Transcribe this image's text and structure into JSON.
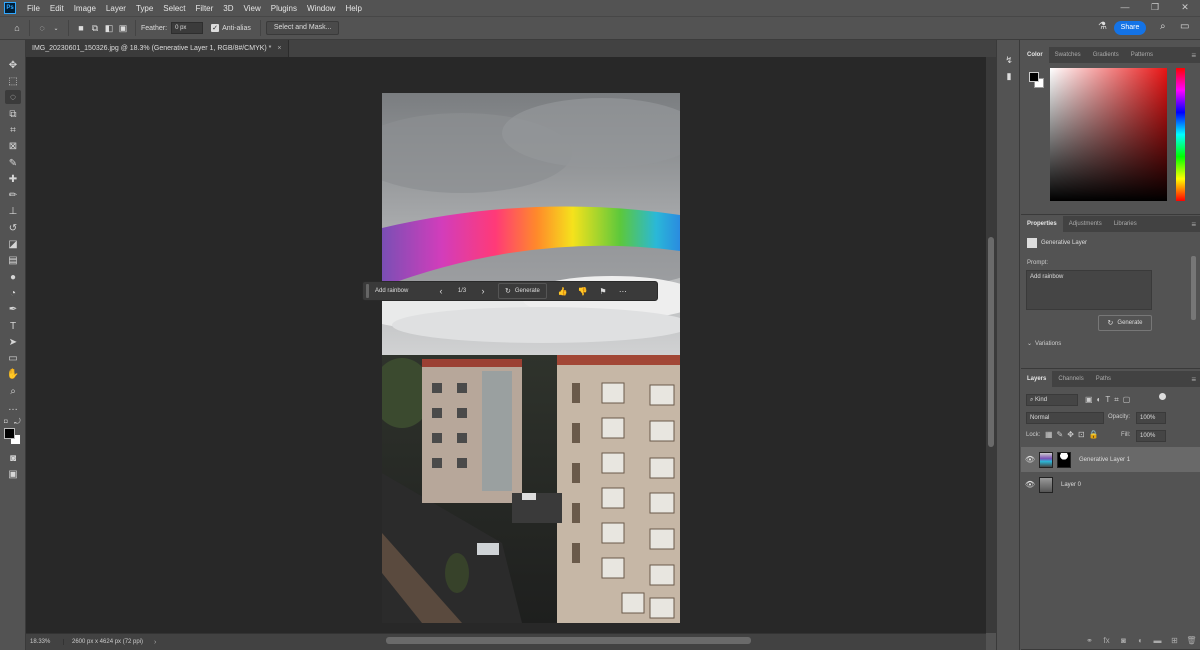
{
  "menubar": {
    "app_logo": "Ps",
    "items": [
      "File",
      "Edit",
      "Image",
      "Layer",
      "Type",
      "Select",
      "Filter",
      "3D",
      "View",
      "Plugins",
      "Window",
      "Help"
    ]
  },
  "options": {
    "feather_label": "Feather:",
    "feather_value": "0 px",
    "antialias_label": "Anti-alias",
    "select_mask_label": "Select and Mask...",
    "share_label": "Share"
  },
  "document": {
    "tab_title": "IMG_20230601_150326.jpg @ 18.3% (Generative Layer 1, RGB/8#/CMYK) *",
    "tab_close": "×"
  },
  "taskbar": {
    "prompt": "Add rainbow",
    "counter": "1/3",
    "generate_label": "Generate"
  },
  "statusbar": {
    "zoom": "18.33%",
    "doc_size": "2600 px x 4624 px (72 ppi)"
  },
  "color_panel": {
    "tabs": [
      "Color",
      "Swatches",
      "Gradients",
      "Patterns"
    ],
    "foreground": "#000000",
    "background": "#ffffff"
  },
  "properties_panel": {
    "tabs": [
      "Properties",
      "Adjustments",
      "Libraries"
    ],
    "layer_type": "Generative Layer",
    "prompt_label": "Prompt:",
    "prompt_value": "Add rainbow",
    "generate_label": "Generate",
    "variations_label": "Variations"
  },
  "layers_panel": {
    "tabs": [
      "Layers",
      "Channels",
      "Paths"
    ],
    "filter_kind": "Kind",
    "blend_mode": "Normal",
    "opacity_label": "Opacity:",
    "opacity_value": "100%",
    "lock_label": "Lock:",
    "fill_label": "Fill:",
    "fill_value": "100%",
    "layers": [
      {
        "name": "Generative Layer 1",
        "selected": true
      },
      {
        "name": "Layer 0",
        "selected": false
      }
    ]
  },
  "colors": {
    "accent": "#1473e6",
    "ui_bg": "#535353",
    "canvas_bg": "#282828"
  }
}
